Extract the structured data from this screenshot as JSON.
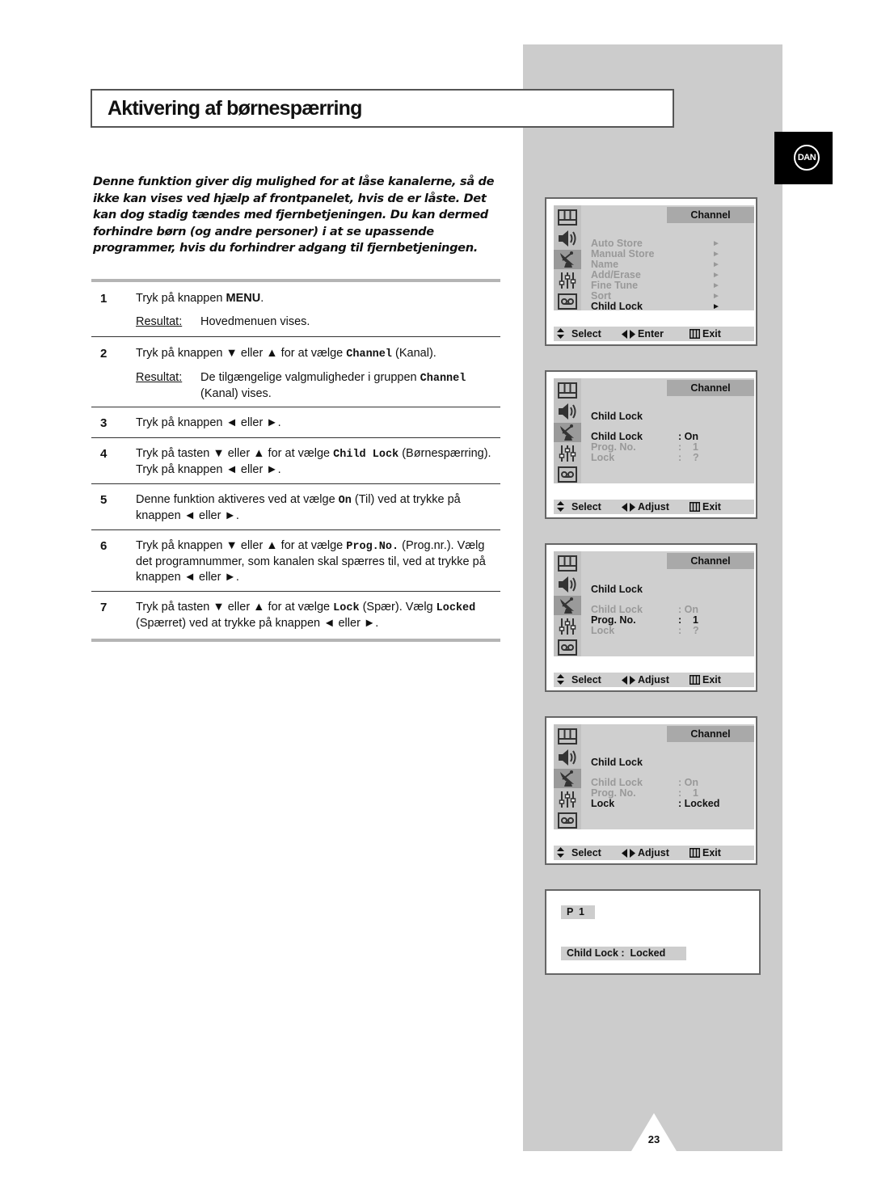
{
  "page": {
    "title": "Aktivering af børnespærring",
    "language_badge": "DAN",
    "page_number": "23",
    "intro": "Denne funktion giver dig mulighed for at låse kanalerne, så de ikke kan vises ved hjælp af frontpanelet, hvis de er låste. Det kan dog stadig tændes med fjernbetjeningen. Du kan dermed forhindre børn (og andre personer) i at se upassende programmer, hvis du forhindrer adgang til fjernbetjeningen."
  },
  "steps": [
    {
      "num": "1",
      "parts": [
        "Tryk på knappen ",
        "MENU",
        "."
      ],
      "result_label": "Resultat:",
      "result": "Hovedmenuen vises."
    },
    {
      "num": "2",
      "parts": [
        "Tryk på knappen ▼ eller ▲ for at vælge ",
        "Channel",
        " (Kanal)."
      ],
      "result_label": "Resultat:",
      "result_parts": [
        "De tilgængelige valgmuligheder i gruppen ",
        "Channel",
        " (Kanal) vises."
      ]
    },
    {
      "num": "3",
      "parts": [
        "Tryk på knappen ◄ eller ►."
      ]
    },
    {
      "num": "4",
      "parts": [
        "Tryk på tasten ▼ eller ▲ for at vælge ",
        "Child Lock",
        " (Børnespærring). Tryk på knappen ◄ eller ►."
      ]
    },
    {
      "num": "5",
      "parts": [
        "Denne funktion aktiveres ved at vælge ",
        "On",
        " (Til) ved at trykke på knappen ◄ eller ►."
      ]
    },
    {
      "num": "6",
      "parts": [
        "Tryk på knappen ▼ eller ▲ for at vælge ",
        "Prog.No.",
        " (Prog.nr.). Vælg det programnummer, som kanalen skal spærres til, ved at trykke på knappen ◄ eller ►."
      ]
    },
    {
      "num": "7",
      "parts": [
        "Tryk på tasten ▼ eller ▲ for at vælge ",
        "Lock",
        " (Spær). Vælg ",
        "Locked",
        " (Spærret) ved at trykke på knappen ◄ eller ►."
      ]
    }
  ],
  "menu_icons": [
    "picture-icon",
    "sound-icon",
    "channel-antenna-icon",
    "setup-equalizer-icon",
    "input-tape-icon"
  ],
  "screens": [
    {
      "tab": "Channel",
      "items": [
        "Auto Store",
        "Manual Store",
        "Name",
        "Add/Erase",
        "Fine Tune",
        "Sort",
        "Child Lock"
      ],
      "selected_item": 6,
      "item_arrow": "►",
      "footer": {
        "select": "Select",
        "action": "Enter",
        "exit": "Exit"
      }
    },
    {
      "tab": "Channel",
      "heading": "Child Lock",
      "rows": [
        {
          "label": "Child Lock",
          "value": ": On"
        },
        {
          "label": "Prog. No.",
          "value": ":    1"
        },
        {
          "label": "Lock",
          "value": ":    ?"
        }
      ],
      "selected_row": 0,
      "footer": {
        "select": "Select",
        "action": "Adjust",
        "exit": "Exit"
      }
    },
    {
      "tab": "Channel",
      "heading": "Child Lock",
      "rows": [
        {
          "label": "Child Lock",
          "value": ": On"
        },
        {
          "label": "Prog. No.",
          "value": ":    1"
        },
        {
          "label": "Lock",
          "value": ":    ?"
        }
      ],
      "selected_row": 1,
      "footer": {
        "select": "Select",
        "action": "Adjust",
        "exit": "Exit"
      }
    },
    {
      "tab": "Channel",
      "heading": "Child Lock",
      "rows": [
        {
          "label": "Child Lock",
          "value": ": On"
        },
        {
          "label": "Prog. No.",
          "value": ":    1"
        },
        {
          "label": "Lock",
          "value": ": Locked"
        }
      ],
      "selected_row": 2,
      "footer": {
        "select": "Select",
        "action": "Adjust",
        "exit": "Exit"
      }
    }
  ],
  "status_screen": {
    "program": "P  1",
    "message": "Child Lock :  Locked"
  }
}
